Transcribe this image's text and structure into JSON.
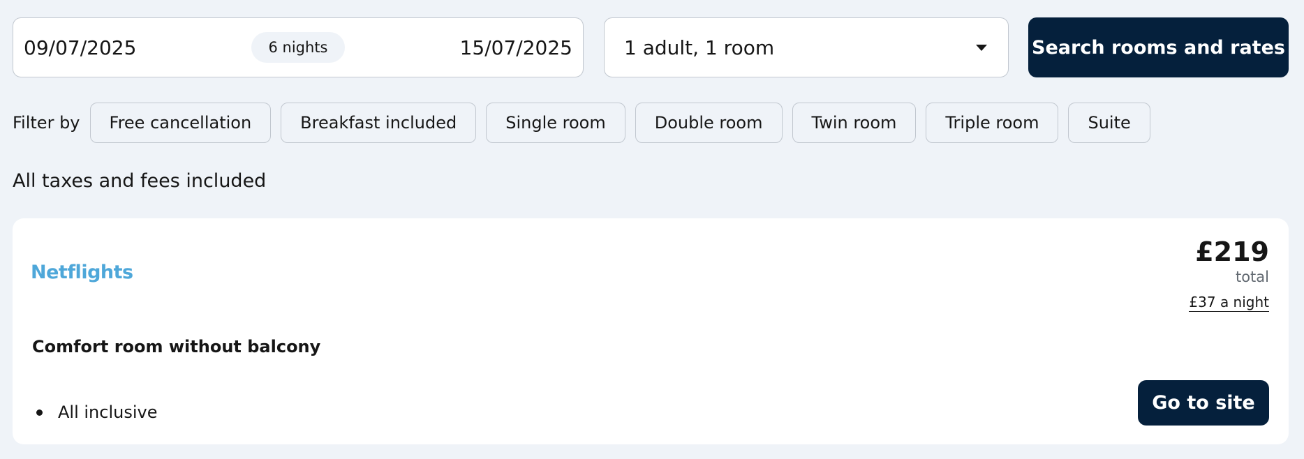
{
  "search": {
    "check_in": "09/07/2025",
    "nights": "6 nights",
    "check_out": "15/07/2025",
    "guests": "1 adult, 1 room",
    "search_label": "Search rooms and rates"
  },
  "filters": {
    "label": "Filter by",
    "chips": [
      "Free cancellation",
      "Breakfast included",
      "Single room",
      "Double room",
      "Twin room",
      "Triple room",
      "Suite"
    ]
  },
  "taxes_note": "All taxes and fees included",
  "offer": {
    "provider": "Netflights",
    "price_total": "£219",
    "total_label": "total",
    "price_per_night": "£37 a night",
    "room_name": "Comfort room without balcony",
    "amenities": [
      "All inclusive"
    ],
    "cta_label": "Go to site"
  },
  "colors": {
    "background": "#eff3f8",
    "primary_button": "#05203c",
    "provider_brand": "#4ea7d9"
  },
  "icons": {
    "guests_dropdown": "caret-down-icon",
    "amenity_bullet": "bullet-icon"
  }
}
